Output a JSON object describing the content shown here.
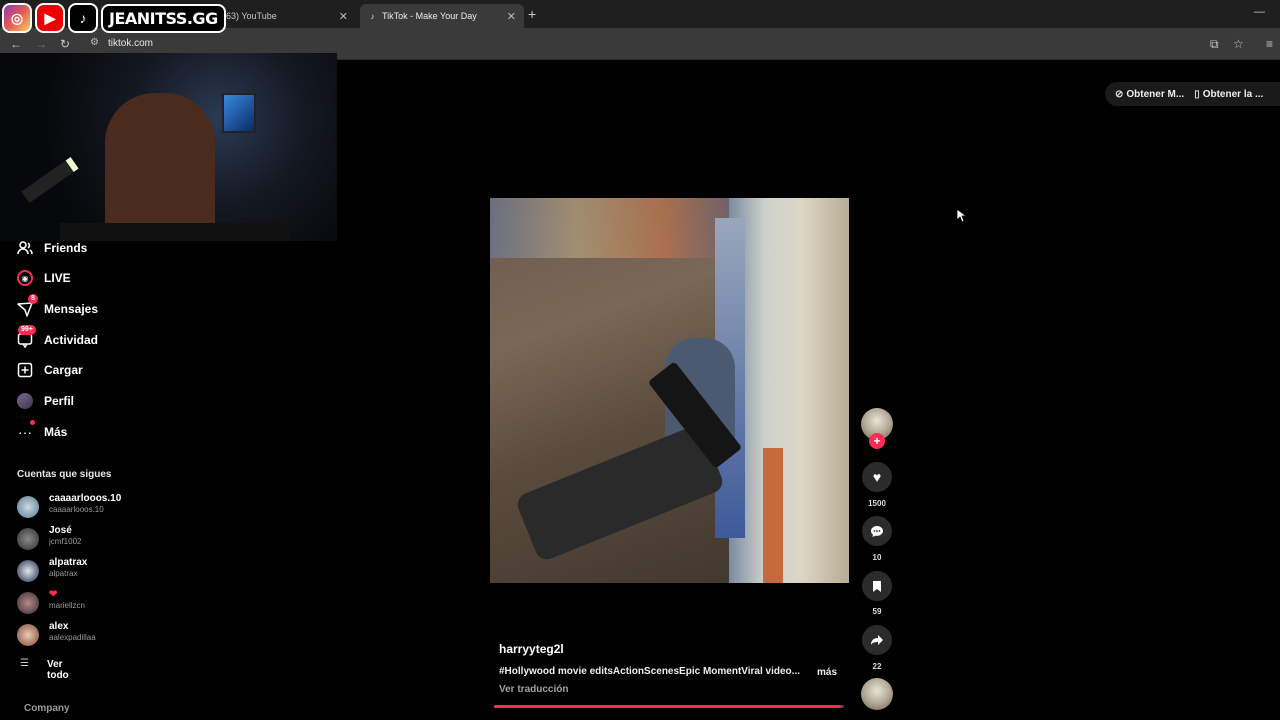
{
  "overlay": {
    "handle": "JEANITSS.GG"
  },
  "browser": {
    "tabs": [
      {
        "title": "(163) YouTube"
      },
      {
        "title": "TikTok - Make Your Day"
      }
    ],
    "url": "tiktok.com"
  },
  "sidebar": {
    "menu": [
      {
        "label": "Friends",
        "icon": "friends-icon"
      },
      {
        "label": "LIVE",
        "icon": "live-icon"
      },
      {
        "label": "Mensajes",
        "icon": "messages-icon",
        "badge": "8"
      },
      {
        "label": "Actividad",
        "icon": "activity-icon",
        "badge": "99+"
      },
      {
        "label": "Cargar",
        "icon": "upload-icon"
      },
      {
        "label": "Perfil",
        "icon": "profile-icon"
      },
      {
        "label": "Más",
        "icon": "more-icon"
      }
    ],
    "following_title": "Cuentas que sigues",
    "following": [
      {
        "name": "caaaarlooos.10",
        "username": "caaaarlooos.10"
      },
      {
        "name": "José",
        "username": "jcmf1002"
      },
      {
        "name": "alpatrax",
        "username": "alpatrax"
      },
      {
        "name": "❤",
        "username": "mariellzcn"
      },
      {
        "name": "alex",
        "username": "aalexpadillaa"
      }
    ],
    "see_all": "Ver todo",
    "company": "Company"
  },
  "top_buttons": {
    "coins": "Obtener M...",
    "app": "Obtener la ..."
  },
  "video": {
    "author": "harryyteg2l",
    "caption": "#Hollywood movie editsActionScenesEpic MomentViral video...",
    "more": "más",
    "translate": "Ver traducción",
    "progress": 0.99
  },
  "actions": {
    "likes": "1500",
    "comments": "10",
    "saves": "59",
    "shares": "22"
  },
  "colors": {
    "accent": "#fe2c55",
    "background": "#000000"
  }
}
